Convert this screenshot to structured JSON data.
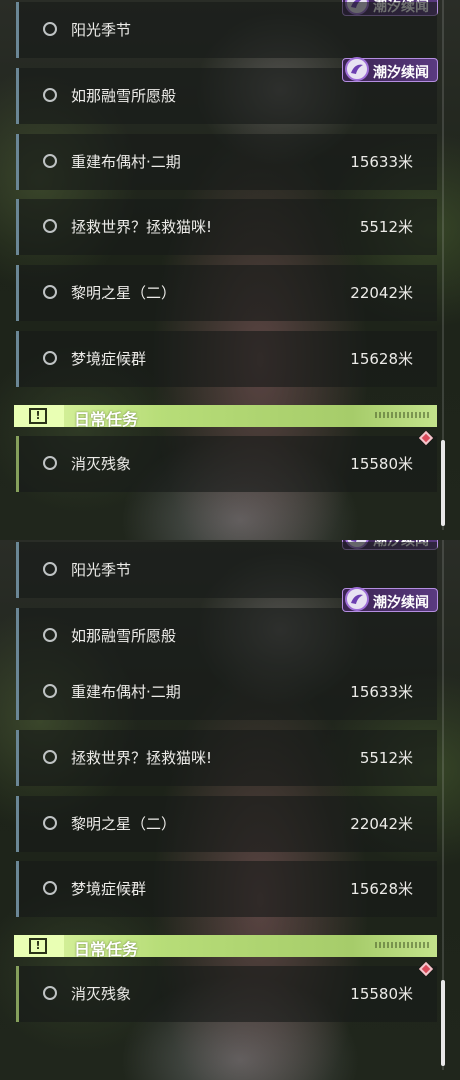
{
  "quests": [
    {
      "label": "阳光季节",
      "distance": ""
    },
    {
      "label": "如那融雪所愿般",
      "distance": ""
    },
    {
      "label": "重建布偶村·二期",
      "distance": "15633米"
    },
    {
      "label": "拯救世界？拯救猫咪!",
      "distance": "5512米"
    },
    {
      "label": "黎明之星（二）",
      "distance": "22042米"
    },
    {
      "label": "梦境症候群",
      "distance": "15628米"
    }
  ],
  "badge": {
    "label": "潮汐续闻",
    "icon": "tide-news-icon"
  },
  "daily_section": {
    "title": "日常任务",
    "icon": "exclamation-icon"
  },
  "daily_quests": [
    {
      "label": "消灭残象",
      "distance": "15580米"
    }
  ],
  "colors": {
    "quest_accent": "#6b8796",
    "daily_accent": "#86a05c",
    "badge": "#5a3a80",
    "section_header": "#b7dd78",
    "notify": "#d94a5a"
  }
}
